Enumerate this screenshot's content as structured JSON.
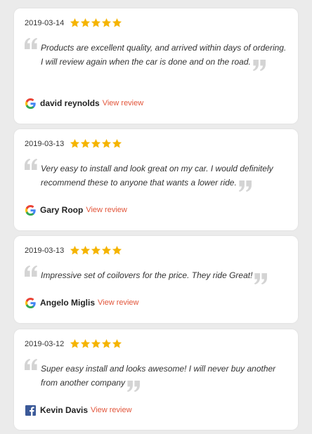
{
  "colors": {
    "background": "#ebebeb",
    "card": "#ffffff",
    "star": "#f5b400",
    "quote_mark": "#d4d4d4",
    "link": "#e2553a",
    "facebook": "#3b5998"
  },
  "reviews": [
    {
      "date": "2019-03-14",
      "rating": 5,
      "text": "Products are excellent quality, and arrived within days of ordering. I will review again when the car is done and on the road.",
      "author": "david reynolds",
      "link_label": "View review",
      "source_icon": "google-icon"
    },
    {
      "date": "2019-03-13",
      "rating": 5,
      "text": "Very easy to install and look great on my car. I would definitely recommend these to anyone that wants a lower ride.",
      "author": "Gary Roop",
      "link_label": "View review",
      "source_icon": "google-icon"
    },
    {
      "date": "2019-03-13",
      "rating": 5,
      "text": "Impressive set of coilovers for the price. They ride Great!",
      "author": "Angelo Miglis",
      "link_label": "View review",
      "source_icon": "google-icon"
    },
    {
      "date": "2019-03-12",
      "rating": 5,
      "text": "Super easy install and looks awesome! I will never buy another from another company",
      "author": "Kevin Davis",
      "link_label": "View review",
      "source_icon": "facebook-icon"
    }
  ]
}
